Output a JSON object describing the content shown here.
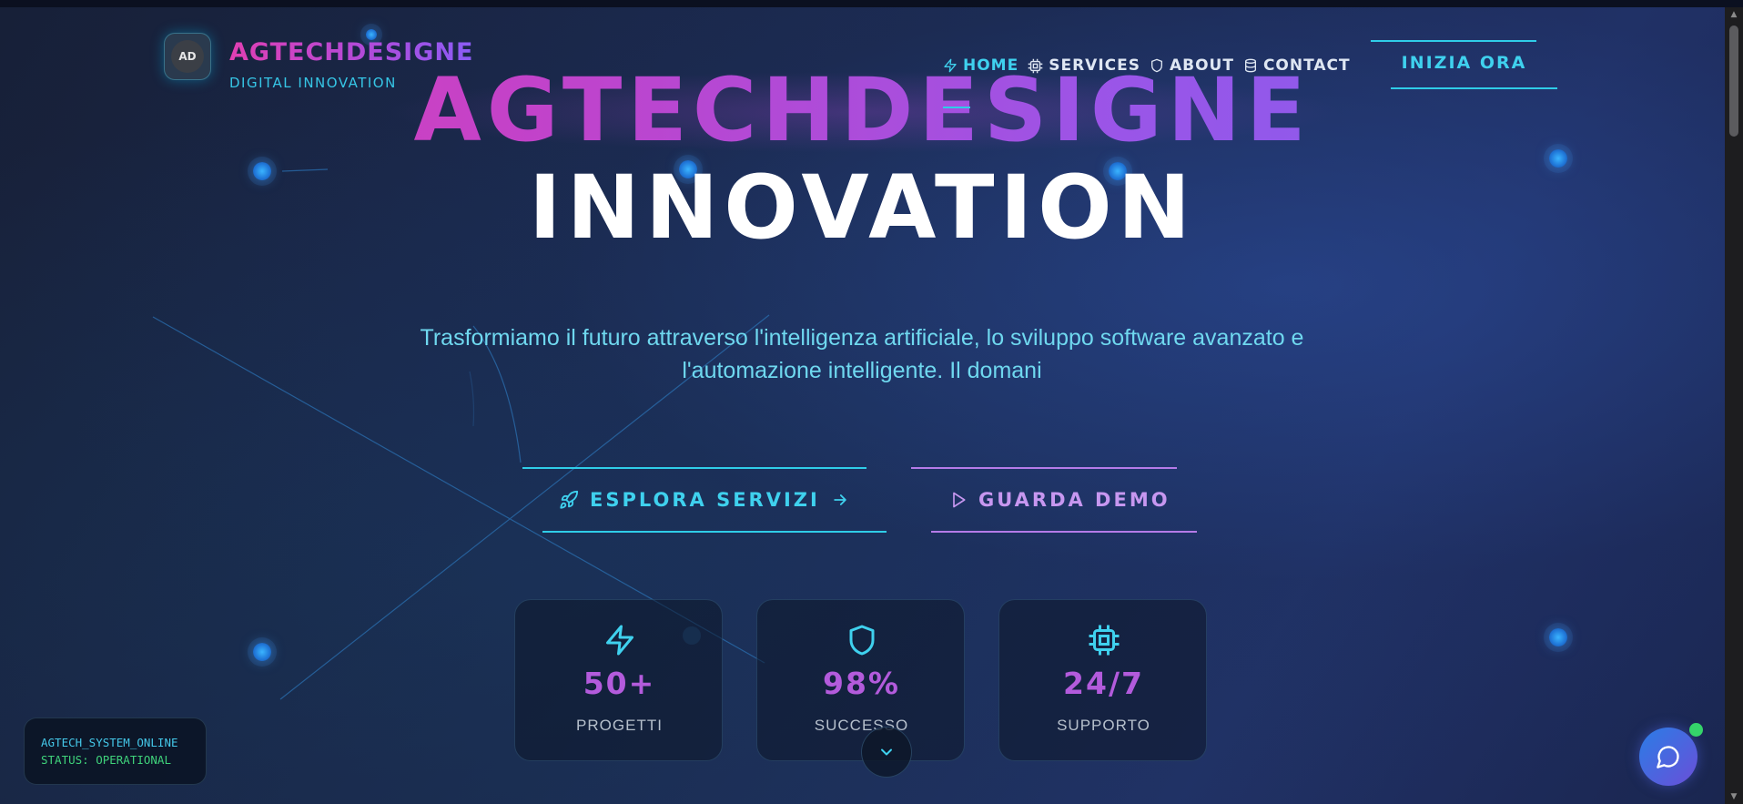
{
  "brand": {
    "logo_text": "AD",
    "title": "AGTECHDESIGNE",
    "subtitle": "DIGITAL INNOVATION"
  },
  "nav": {
    "items": [
      {
        "label": "HOME",
        "icon": "zap-icon",
        "active": true
      },
      {
        "label": "SERVICES",
        "icon": "cpu-icon",
        "active": false
      },
      {
        "label": "ABOUT",
        "icon": "shield-icon",
        "active": false
      },
      {
        "label": "CONTACT",
        "icon": "database-icon",
        "active": false
      }
    ],
    "cta_label": "INIZIA ORA"
  },
  "hero": {
    "title": "AGTECHDESIGNE",
    "subtitle": "INNOVATION",
    "description": "Trasformiamo il futuro attraverso l'intelligenza artificiale, lo sviluppo software avanzato e l'automazione intelligente. Il domani"
  },
  "buttons": {
    "primary": {
      "label": "ESPLORA SERVIZI",
      "icon": "rocket-icon",
      "trailing_icon": "arrow-right-icon"
    },
    "secondary": {
      "label": "GUARDA DEMO",
      "icon": "play-icon"
    }
  },
  "stats": [
    {
      "value": "50+",
      "label": "PROGETTI",
      "icon": "zap-icon"
    },
    {
      "value": "98%",
      "label": "SUCCESSO",
      "icon": "shield-icon"
    },
    {
      "value": "24/7",
      "label": "SUPPORTO",
      "icon": "cpu-icon"
    }
  ],
  "status_panel": {
    "line1": "AGTECH_SYSTEM_ONLINE",
    "line2": "STATUS: OPERATIONAL"
  },
  "colors": {
    "accent_cyan": "#2fcde8",
    "accent_purple": "#b57be8",
    "gradient_pink": "#e13fb2",
    "gradient_violet": "#7c62f0",
    "online_green": "#35d46a"
  }
}
